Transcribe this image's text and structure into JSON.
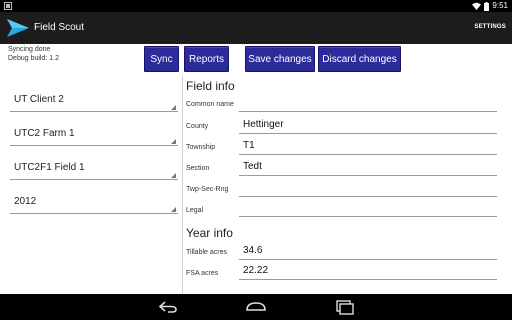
{
  "status_bar": {
    "clock": "9:51"
  },
  "action_bar": {
    "title": "Field Scout",
    "settings_label": "SETTINGS"
  },
  "sync": {
    "status": "Syncing done",
    "build": "Debug build: 1.2"
  },
  "toolbar": {
    "sync_label": "Sync",
    "reports_label": "Reports",
    "save_label": "Save changes",
    "discard_label": "Discard changes"
  },
  "spinners": [
    {
      "value": "UT Client 2"
    },
    {
      "value": "UTC2 Farm 1"
    },
    {
      "value": "UTC2F1 Field 1"
    },
    {
      "value": "2012"
    }
  ],
  "field_info": {
    "heading": "Field info",
    "fields": [
      {
        "label": "Common name",
        "value": ""
      },
      {
        "label": "County",
        "value": "Hettinger"
      },
      {
        "label": "Township",
        "value": "T1"
      },
      {
        "label": "Section",
        "value": "Tedt"
      },
      {
        "label": "Twp-Sec-Rng",
        "value": ""
      },
      {
        "label": "Legal",
        "value": ""
      }
    ]
  },
  "year_info": {
    "heading": "Year info",
    "fields": [
      {
        "label": "Tillable acres",
        "value": "34.6"
      },
      {
        "label": "FSA acres",
        "value": "22.22"
      }
    ]
  },
  "icons": {
    "app": "field-scout-arrow-icon",
    "wifi": "wifi-icon",
    "battery": "battery-icon",
    "back": "back-icon",
    "home": "home-icon",
    "recents": "recents-icon"
  },
  "colors": {
    "button_bg": "#2b2b9a",
    "action_bar_bg": "#1c1c1c",
    "app_icon": "#29a8e0"
  }
}
